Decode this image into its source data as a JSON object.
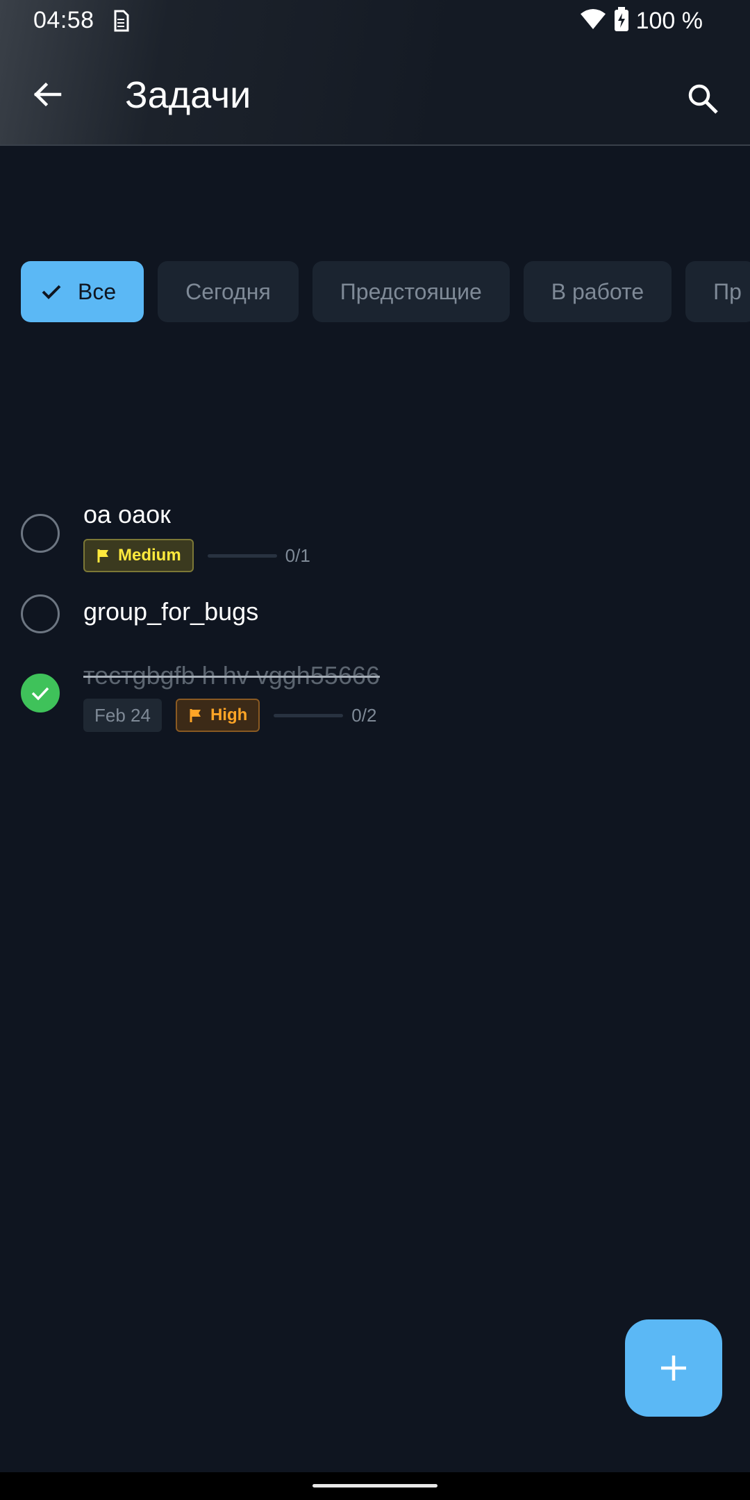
{
  "status_bar": {
    "time": "04:58",
    "battery": "100 %",
    "icons": [
      "sim-icon",
      "wifi-icon",
      "battery-charging-icon"
    ]
  },
  "app_bar": {
    "title": "Задачи",
    "back_icon": "arrow-left-icon",
    "search_icon": "search-icon"
  },
  "filters": {
    "items": [
      {
        "label": "Все",
        "active": true
      },
      {
        "label": "Сегодня",
        "active": false
      },
      {
        "label": "Предстоящие",
        "active": false
      },
      {
        "label": "В работе",
        "active": false
      },
      {
        "label": "Пр",
        "active": false
      }
    ]
  },
  "tasks": [
    {
      "title": "оа оаок",
      "done": false,
      "priority": "Medium",
      "progress_text": "0/1",
      "progress": 0
    },
    {
      "title": "group_for_bugs",
      "done": false
    },
    {
      "title": "тестgbgfb h hv vggh55666",
      "done": true,
      "date": "Feb 24",
      "priority": "High",
      "progress_text": "0/2",
      "progress": 0
    }
  ],
  "fab": {
    "icon": "plus-icon"
  },
  "colors": {
    "background": "#0f1520",
    "accent": "#5bb8f5",
    "done_green": "#3fc25a",
    "medium_yellow": "#ffea3d",
    "high_orange": "#ffa526"
  }
}
